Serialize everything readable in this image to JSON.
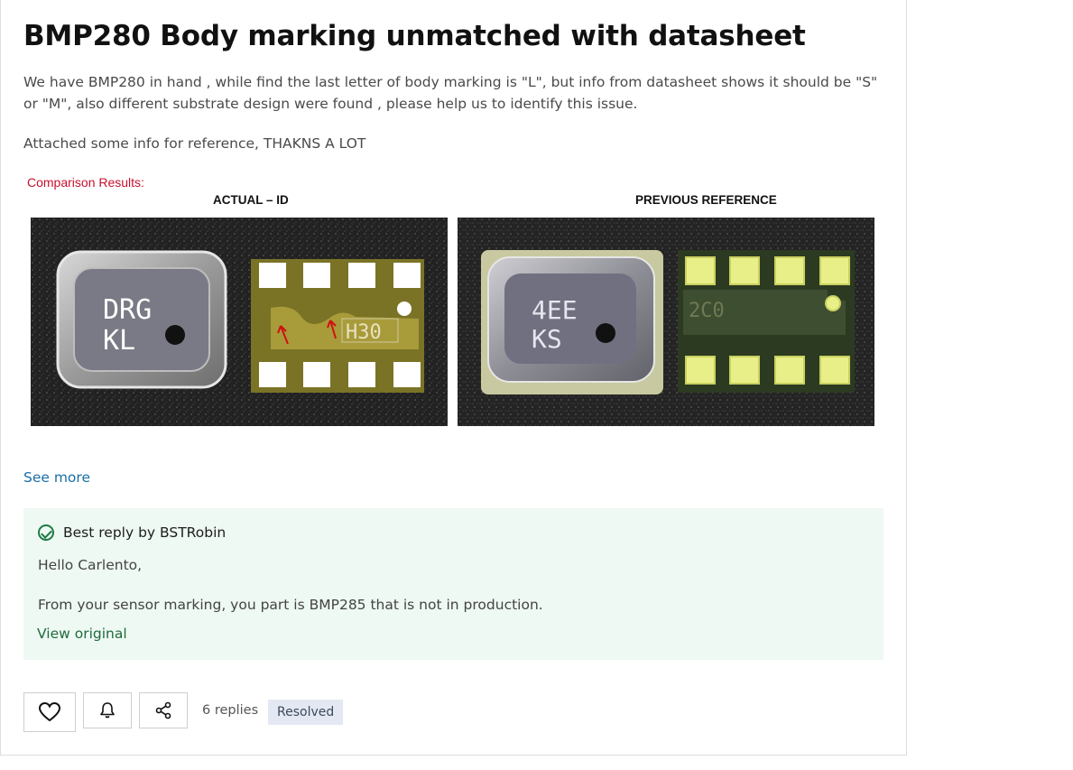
{
  "post": {
    "title": "BMP280 Body marking unmatched with datasheet",
    "body_p1": "We have BMP280 in hand , while find the last letter of body marking is \"L\", but info from datasheet shows it should be \"S\" or \"M\", also different substrate design were found , please help us to identify this issue.",
    "body_p2": "Attached some info for reference, THAKNS A LOT",
    "see_more": "See more"
  },
  "figure": {
    "caption": "Comparison Results:",
    "label_left": "ACTUAL – ID",
    "label_right": "PREVIOUS  REFERENCE",
    "left_chip_marking": [
      "DRG",
      "KL"
    ],
    "left_substrate_marking": "H30",
    "right_chip_marking": [
      "4EE",
      "KS"
    ],
    "right_substrate_marking": "2C0"
  },
  "best_reply": {
    "heading": "Best reply by BSTRobin",
    "line1": "Hello Carlento,",
    "line2": "From your sensor marking, you part is BMP285 that is not in production.",
    "view_original": "View original"
  },
  "footer": {
    "replies": "6 replies",
    "status": "Resolved"
  },
  "icons": {
    "like": "heart-icon",
    "subscribe": "bell-icon",
    "share": "share-icon",
    "accepted": "check-circle-icon"
  },
  "colors": {
    "title": "#111111",
    "link": "#1a6fa6",
    "best_reply_bg": "#eef9f3",
    "accent_green": "#1e7a46",
    "caption_red": "#c8102e",
    "badge_bg": "#e4e8f2"
  }
}
